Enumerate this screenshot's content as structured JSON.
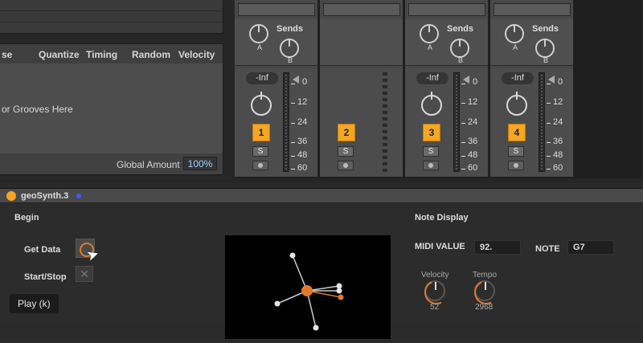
{
  "groove_pool": {
    "columns": [
      "se",
      "Quantize",
      "Timing",
      "Random",
      "Velocity"
    ],
    "hint": "or Grooves Here",
    "global_amount_label": "Global Amount",
    "global_amount_value": "100%"
  },
  "mixer": {
    "sends_label": "Sends",
    "send_a": "A",
    "send_b": "B",
    "volume_label": "-Inf",
    "scale": [
      "0",
      "12",
      "24",
      "36",
      "48",
      "60"
    ],
    "solo_label": "S",
    "tracks": [
      {
        "number": "1"
      },
      {
        "number": "2"
      },
      {
        "number": "3"
      },
      {
        "number": "4"
      }
    ]
  },
  "device": {
    "title": "geoSynth.3",
    "begin_label": "Begin",
    "get_data_label": "Get Data",
    "start_stop_label": "Start/Stop",
    "stop_glyph": "✕",
    "note_display_label": "Note Display",
    "midi_value_label": "MIDI VALUE",
    "midi_value": "92.",
    "note_label": "NOTE",
    "note_value": "G7",
    "velocity_label": "Velocity",
    "velocity_value": "52",
    "tempo_label": "Tempo",
    "tempo_value": "2968"
  },
  "tooltip": "Play (k)",
  "colors": {
    "accent_orange": "#f5a623",
    "knob_orange": "#e07a2c",
    "device_blue_dot": "#3b5bff"
  }
}
